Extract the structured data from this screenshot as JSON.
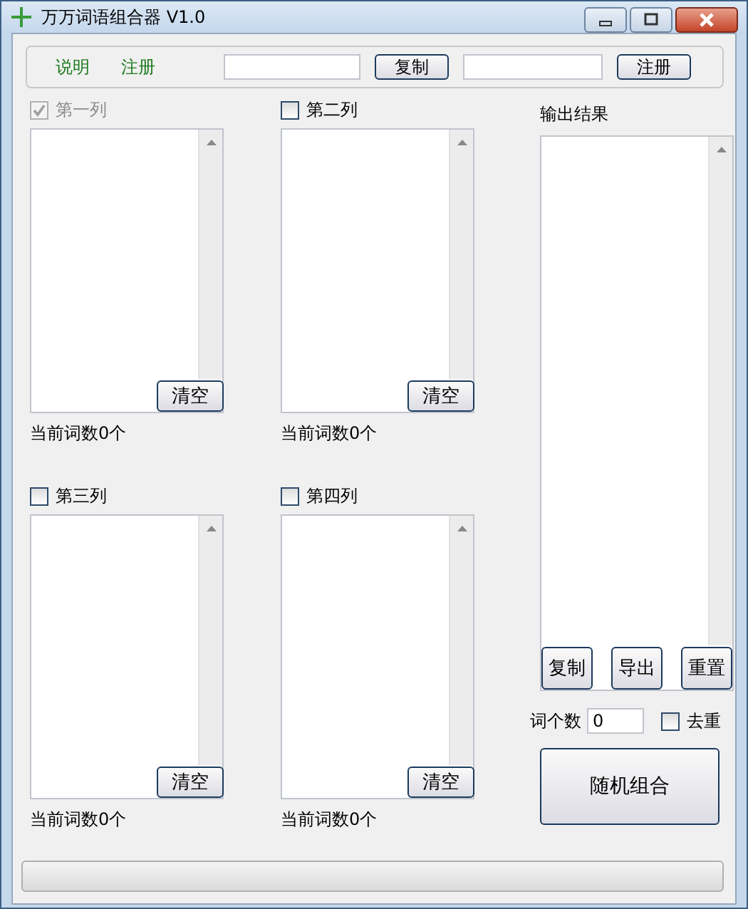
{
  "window": {
    "title": "万万词语组合器 V1.0"
  },
  "top_bar": {
    "links": [
      "说明",
      "注册"
    ],
    "buttons": [
      "复制",
      "注册"
    ]
  },
  "columns": [
    {
      "label": "第一列",
      "checked": true,
      "disabled": true,
      "clear_button": "清空",
      "count": "当前词数0个"
    },
    {
      "label": "第二列",
      "checked": false,
      "disabled": false,
      "clear_button": "清空",
      "count": "当前词数0个"
    },
    {
      "label": "第三列",
      "checked": false,
      "disabled": false,
      "clear_button": "清空",
      "count": "当前词数0个"
    },
    {
      "label": "第四列",
      "checked": false,
      "disabled": false,
      "clear_button": "清空",
      "count": "当前词数0个"
    }
  ],
  "output": {
    "label": "输出结果",
    "buttons": [
      "复制",
      "导出",
      "重置"
    ]
  },
  "word_count": {
    "label": "词个数",
    "value": "0"
  },
  "dedupe": {
    "label": "去重",
    "checked": false
  },
  "generate_button": "随机组合",
  "progress": {
    "level": 0
  }
}
